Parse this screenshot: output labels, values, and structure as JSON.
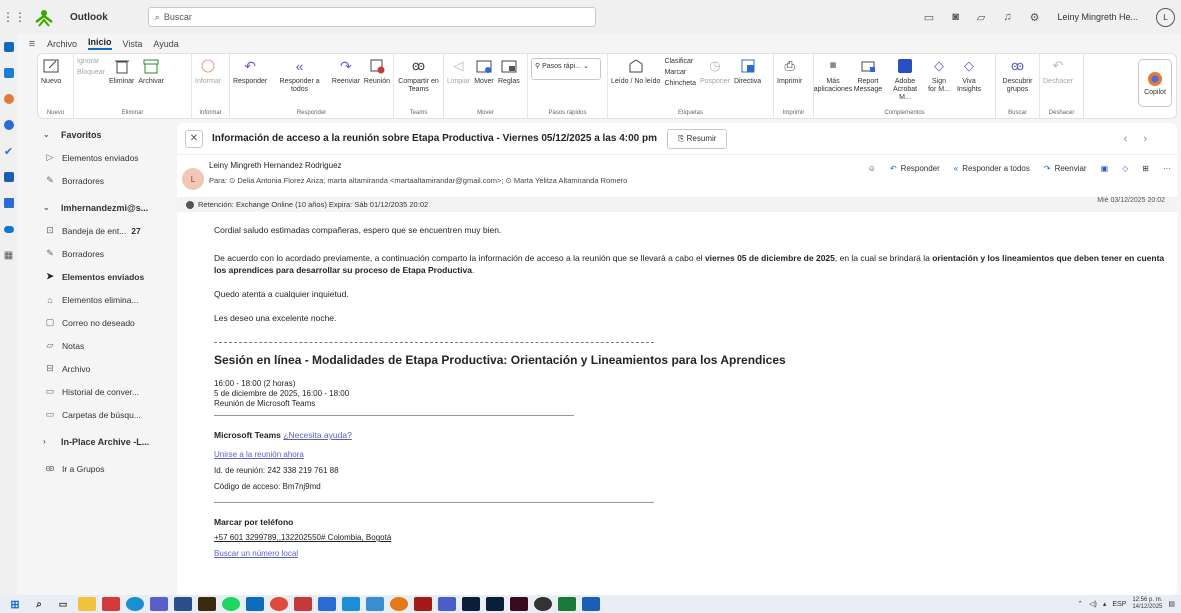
{
  "app": {
    "name": "Outlook",
    "search_placeholder": "Buscar",
    "user_name": "Leiny Mingreth He...",
    "user_initial": "L"
  },
  "menu": {
    "items": [
      "Archivo",
      "Inicio",
      "Vista",
      "Ayuda"
    ],
    "active": "Inicio"
  },
  "ribbon": {
    "nuevo": {
      "label": "Nuevo",
      "group": "Nuevo"
    },
    "eliminar": {
      "ignorar": "Ignorar",
      "bloquear": "Bloquear",
      "eliminar": "Eliminar",
      "archivar": "Archivar",
      "group": "Eliminar"
    },
    "informar": {
      "label": "Informar",
      "group": "Informar"
    },
    "responder": {
      "responder": "Responder",
      "responder_todos": "Responder a todos",
      "reenviar": "Reenviar",
      "reunion": "Reunión",
      "group": "Responder"
    },
    "teams": {
      "label": "Compartir en Teams",
      "group": "Teams"
    },
    "mover": {
      "limpiar": "Limpiar",
      "mover": "Mover",
      "reglas": "Reglas",
      "group": "Mover"
    },
    "pasos": {
      "placeholder": "Pasos rápi...",
      "group": "Pasos rápidos"
    },
    "etiquetas": {
      "leido": "Leído / No leído",
      "clasificar": "Clasificar",
      "marcar": "Marcar",
      "chincheta": "Chincheta",
      "posponer": "Posponer",
      "directiva": "Directiva",
      "group": "Etiquetas"
    },
    "imprimir": {
      "label": "Imprimir",
      "group": "Imprimir"
    },
    "complementos": {
      "mas": "Más aplicaciones",
      "report": "Report Message",
      "adobe": "Adobe Acrobat M...",
      "sign": "Sign for M...",
      "viva": "Viva Insights",
      "group": "Complementos"
    },
    "buscar": {
      "label": "Descubrir grupos",
      "group": "Buscar"
    },
    "deshacer": {
      "label": "Deshacer",
      "group": "Deshacer"
    },
    "copilot": "Copilot"
  },
  "nav": {
    "favoritos": "Favoritos",
    "fav_items": [
      "Elementos enviados",
      "Borradores"
    ],
    "account": "lmhernandezmi@s...",
    "items": [
      {
        "label": "Bandeja de ent...",
        "count": "27"
      },
      {
        "label": "Borradores",
        "count": ""
      },
      {
        "label": "Elementos enviados",
        "count": ""
      },
      {
        "label": "Elementos elimina...",
        "count": ""
      },
      {
        "label": "Correo no deseado",
        "count": ""
      },
      {
        "label": "Notas",
        "count": ""
      },
      {
        "label": "Archivo",
        "count": ""
      },
      {
        "label": "Historial de conver...",
        "count": ""
      },
      {
        "label": "Carpetas de búsqu...",
        "count": ""
      }
    ],
    "archive": "In-Place Archive -L...",
    "groups": "Ir a Grupos"
  },
  "email": {
    "subject": "Información de acceso a la reunión sobre Etapa Productiva - Viernes 05/12/2025 a las 4:00 pm",
    "summarize": "Resumir",
    "sender": "Leiny Mingreth Hernandez Rodriguez",
    "sender_initial": "L",
    "to": "Para: ⊙ Delia Antonia Florez Ariza;  marta altamiranda <martaaltamirandar@gmail.com>;  ⊙ Marta Yelitza Altamiranda Romero",
    "date": "Mié 03/12/2025 20:02",
    "retention": "Retención: Exchange Online (10 años) Expira: Sáb 01/12/2035 20:02",
    "actions": {
      "responder": "Responder",
      "responder_todos": "Responder a todos",
      "reenviar": "Reenviar"
    },
    "greeting": "Cordial saludo estimadas compañeras, espero que se encuentren muy bien.",
    "p1_a": "De acuerdo con lo  acordado previamente, a continuación comparto la información de acceso a la reunión que se llevará a cabo el ",
    "p1_b": "viernes 05 de diciembre de 2025",
    "p1_c": ", en la cual se brindará la ",
    "p1_d": "orientación y los lineamientos que deben tener en cuenta los aprendices para desarrollar su proceso de Etapa Productiva",
    "p1_e": ".",
    "p2": "Quedo atenta a cualquier inquietud.",
    "p3": "Les deseo una excelente noche.",
    "meeting_title": "Sesión en línea - Modalidades de Etapa Productiva: Orientación y Lineamientos para los Aprendices",
    "time1": "16:00 - 18:00 (2 horas)",
    "time2": "5 de diciembre de 2025, 16:00 - 18:00",
    "platform": "Reunión de Microsoft Teams",
    "teams_title": "Microsoft Teams",
    "help_link": "¿Necesita ayuda?",
    "join_link": "Unirse a la reunión ahora",
    "meeting_id": "Id. de reunión: 242 338 219 761 88",
    "passcode": "Código de acceso: Bm7nj9md",
    "dial_title": "Marcar por teléfono",
    "phone": "+57 601 3299789,,132202550# Colombia, Bogotá",
    "find_number": "Buscar un número local"
  },
  "taskbar": {
    "lang": "ESP",
    "time": "12:56 p. m.",
    "date": "14/12/2025"
  }
}
